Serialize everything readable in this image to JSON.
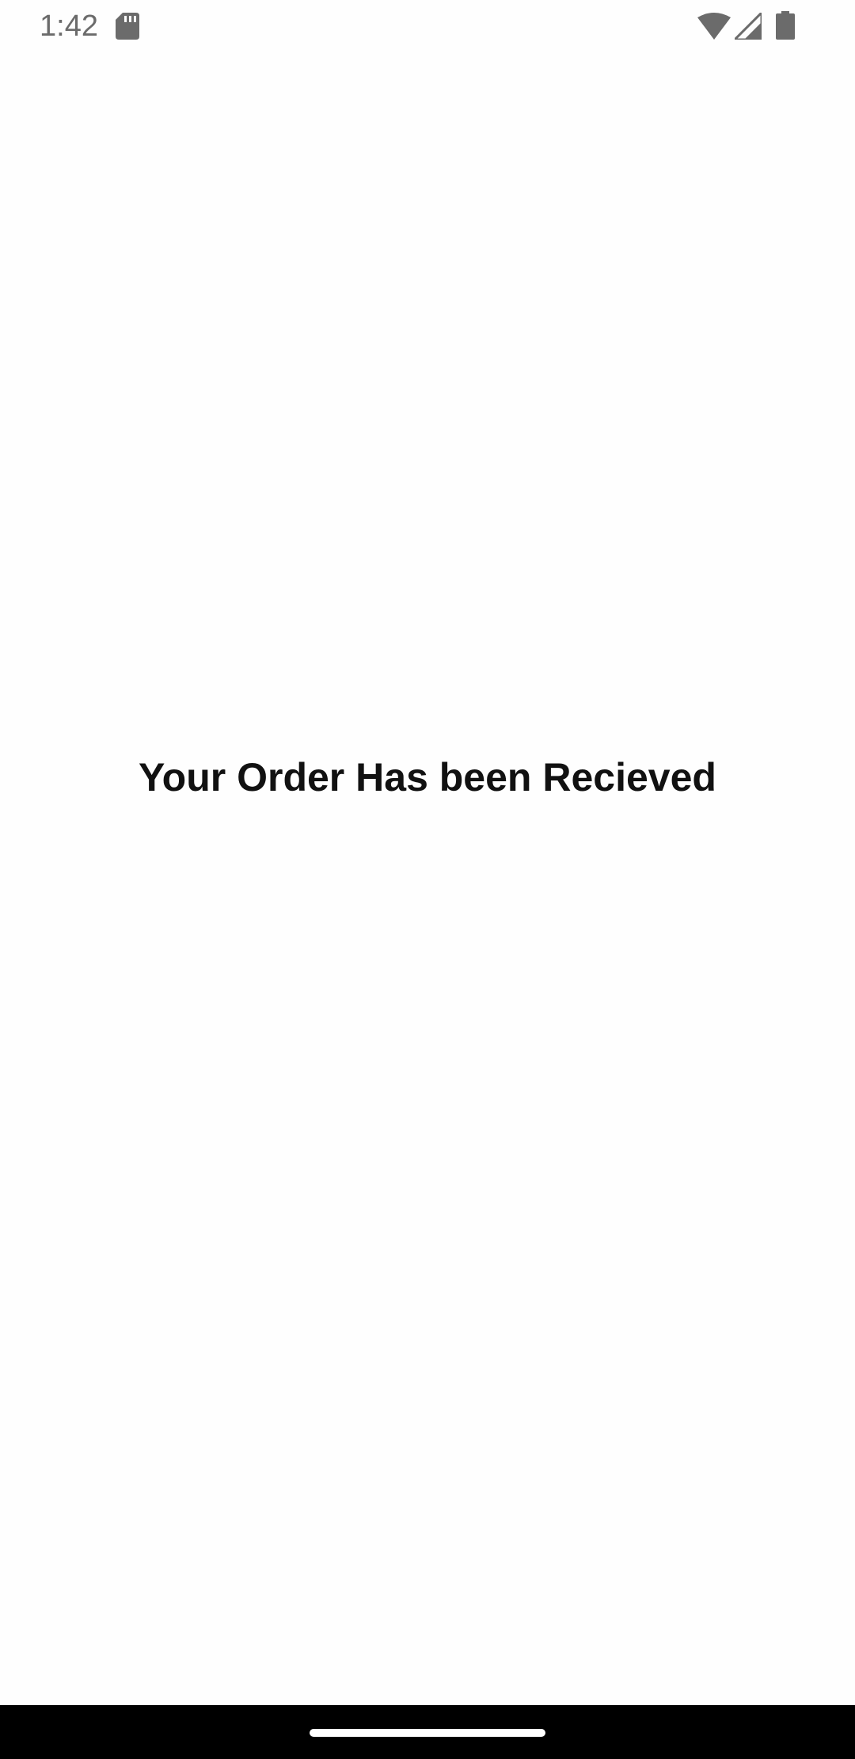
{
  "status_bar": {
    "time": "1:42",
    "icons": [
      "sd-card-icon",
      "wifi-icon",
      "cell-signal-icon",
      "battery-icon"
    ]
  },
  "main": {
    "message": "Your Order Has been Recieved"
  },
  "nav_bar": {
    "home_handle": "home-indicator"
  },
  "colors": {
    "background": "#fefefe",
    "status_text": "#6b6b6b",
    "message_text": "#111111",
    "nav_background": "#000000",
    "nav_handle": "#ffffff"
  }
}
